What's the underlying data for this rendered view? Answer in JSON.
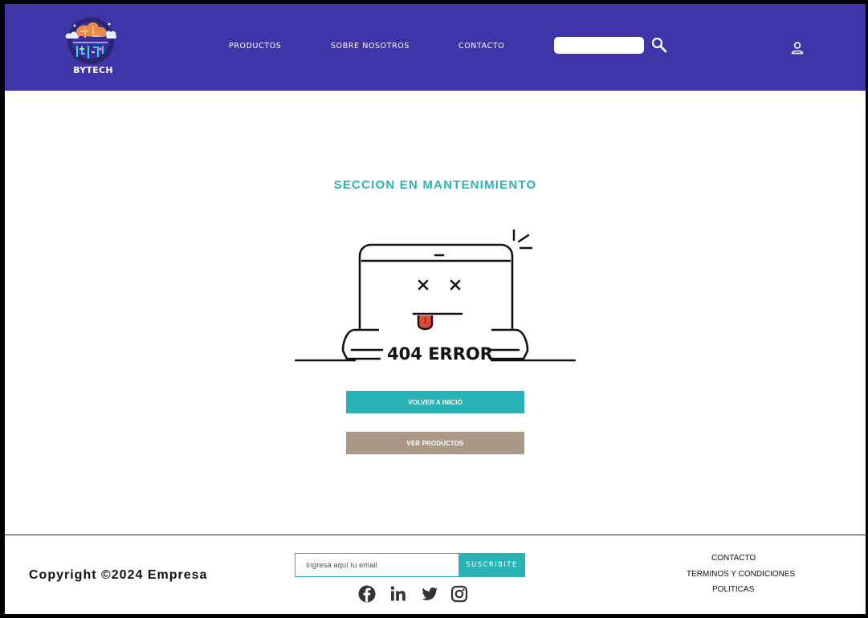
{
  "header": {
    "brand": "BYTECH",
    "nav": [
      {
        "label": "PRODUCTOS"
      },
      {
        "label": "SOBRE NOSOTROS"
      },
      {
        "label": "CONTACTO"
      }
    ],
    "search": {
      "placeholder": "",
      "value": ""
    },
    "icons": {
      "search": "search-icon",
      "user": "user-icon"
    }
  },
  "main": {
    "title": "SECCION EN MANTENIMIENTO",
    "error_text": "404 ERROR",
    "buttons": {
      "home": "VOLVER A INICIO",
      "products": "VER PRODUCTOS"
    }
  },
  "footer": {
    "copyright": "Copyright ©2024 Empresa",
    "newsletter": {
      "placeholder": "Ingresá aquí tu email",
      "button": "SUSCRIBITE"
    },
    "social": [
      "facebook-icon",
      "linkedin-icon",
      "twitter-icon",
      "instagram-icon"
    ],
    "links": [
      "CONTACTO",
      "TERMINOS Y CONDICIONES",
      "POLITICAS"
    ]
  },
  "colors": {
    "header_bg": "#3f34a8",
    "accent": "#2ab3b6",
    "secondary_button": "#aa9988",
    "error_tongue": "#e04a3a"
  }
}
